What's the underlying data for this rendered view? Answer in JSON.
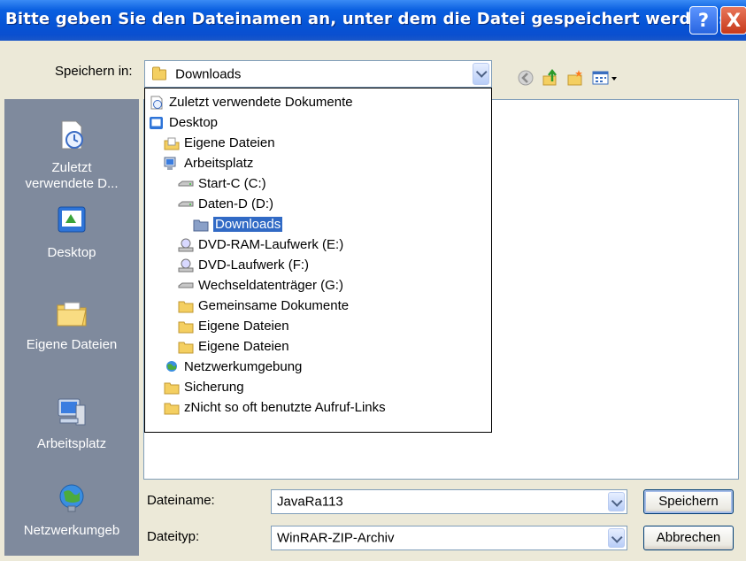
{
  "window": {
    "title": "Bitte geben Sie den Dateinamen an, unter dem die Datei gespeichert werden s...",
    "help_label": "?",
    "close_label": "X"
  },
  "toolbar": {
    "save_in_label": "Speichern in:",
    "location_value": "Downloads",
    "icons": [
      "back-icon",
      "up-folder-icon",
      "new-folder-icon",
      "view-menu-icon"
    ]
  },
  "places": [
    {
      "label": "Zuletzt verwendete D...",
      "label_line1": "Zuletzt",
      "label_line2": "verwendete D...",
      "icon": "recent-documents-icon"
    },
    {
      "label": "Desktop",
      "icon": "desktop-icon"
    },
    {
      "label": "Eigene Dateien",
      "icon": "my-documents-icon"
    },
    {
      "label": "Arbeitsplatz",
      "icon": "my-computer-icon"
    },
    {
      "label": "Netzwerkumgeb",
      "icon": "network-icon"
    }
  ],
  "dropdown_items": [
    {
      "label": "Zuletzt verwendete Dokumente",
      "icon": "recent-icon",
      "indent": 0
    },
    {
      "label": "Desktop",
      "icon": "desktop-icon",
      "indent": 0
    },
    {
      "label": "Eigene Dateien",
      "icon": "my-documents-icon",
      "indent": 1
    },
    {
      "label": "Arbeitsplatz",
      "icon": "my-computer-icon",
      "indent": 1
    },
    {
      "label": "Start-C (C:)",
      "icon": "drive-icon",
      "indent": 2
    },
    {
      "label": "Daten-D (D:)",
      "icon": "drive-icon",
      "indent": 2
    },
    {
      "label": "Downloads",
      "icon": "folder-icon",
      "indent": 3,
      "selected": true
    },
    {
      "label": "DVD-RAM-Laufwerk (E:)",
      "icon": "dvd-drive-icon",
      "indent": 2
    },
    {
      "label": "DVD-Laufwerk (F:)",
      "icon": "dvd-drive-icon",
      "indent": 2
    },
    {
      "label": "Wechseldatenträger (G:)",
      "icon": "drive-icon",
      "indent": 2
    },
    {
      "label": "Gemeinsame Dokumente",
      "icon": "folder-icon",
      "indent": 2
    },
    {
      "label": "Eigene Dateien",
      "icon": "folder-icon",
      "indent": 2
    },
    {
      "label": "Eigene Dateien",
      "icon": "folder-icon",
      "indent": 2
    },
    {
      "label": "Netzwerkumgebung",
      "icon": "network-icon",
      "indent": 1
    },
    {
      "label": "Sicherung",
      "icon": "folder-icon",
      "indent": 1
    },
    {
      "label": "zNicht so oft benutzte Aufruf-Links",
      "icon": "folder-icon",
      "indent": 1
    }
  ],
  "form": {
    "filename_label": "Dateiname:",
    "filename_value": "JavaRa113",
    "filetype_label": "Dateityp:",
    "filetype_value": "WinRAR-ZIP-Archiv"
  },
  "buttons": {
    "save": "Speichern",
    "cancel": "Abbrechen"
  },
  "colors": {
    "titlebar": "#0654d6",
    "selection": "#316ac5",
    "places_bg": "#7f8a9d"
  }
}
